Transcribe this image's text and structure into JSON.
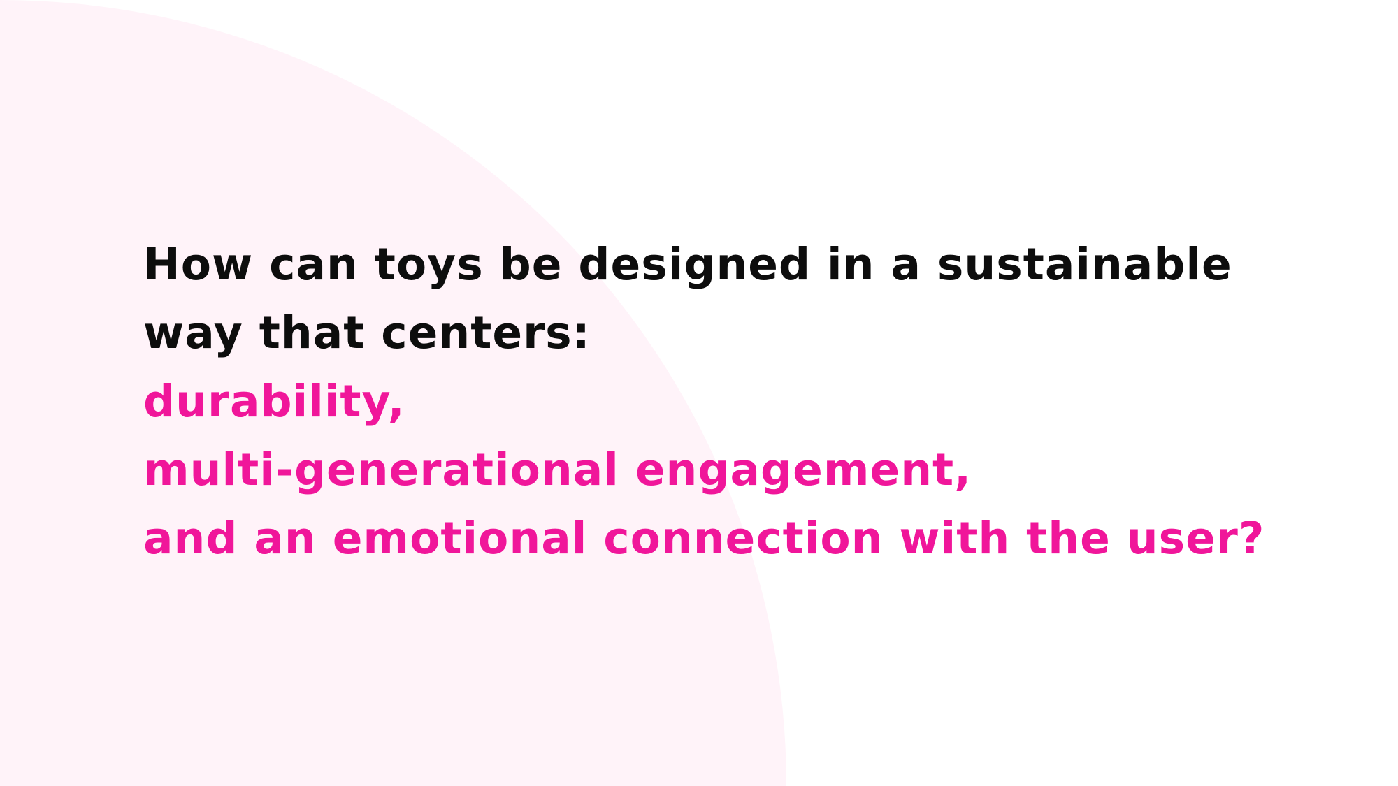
{
  "slide": {
    "question_lines": [
      "How can toys be designed in a sustainable",
      "way that centers:"
    ],
    "highlight_lines": [
      "durability,",
      "multi-generational engagement,",
      "and an emotional connection with the user?"
    ]
  },
  "colors": {
    "background": "#ffffff",
    "shape": "#fff3f9",
    "text_dark": "#0d0d0d",
    "accent_pink": "#f0169a"
  }
}
